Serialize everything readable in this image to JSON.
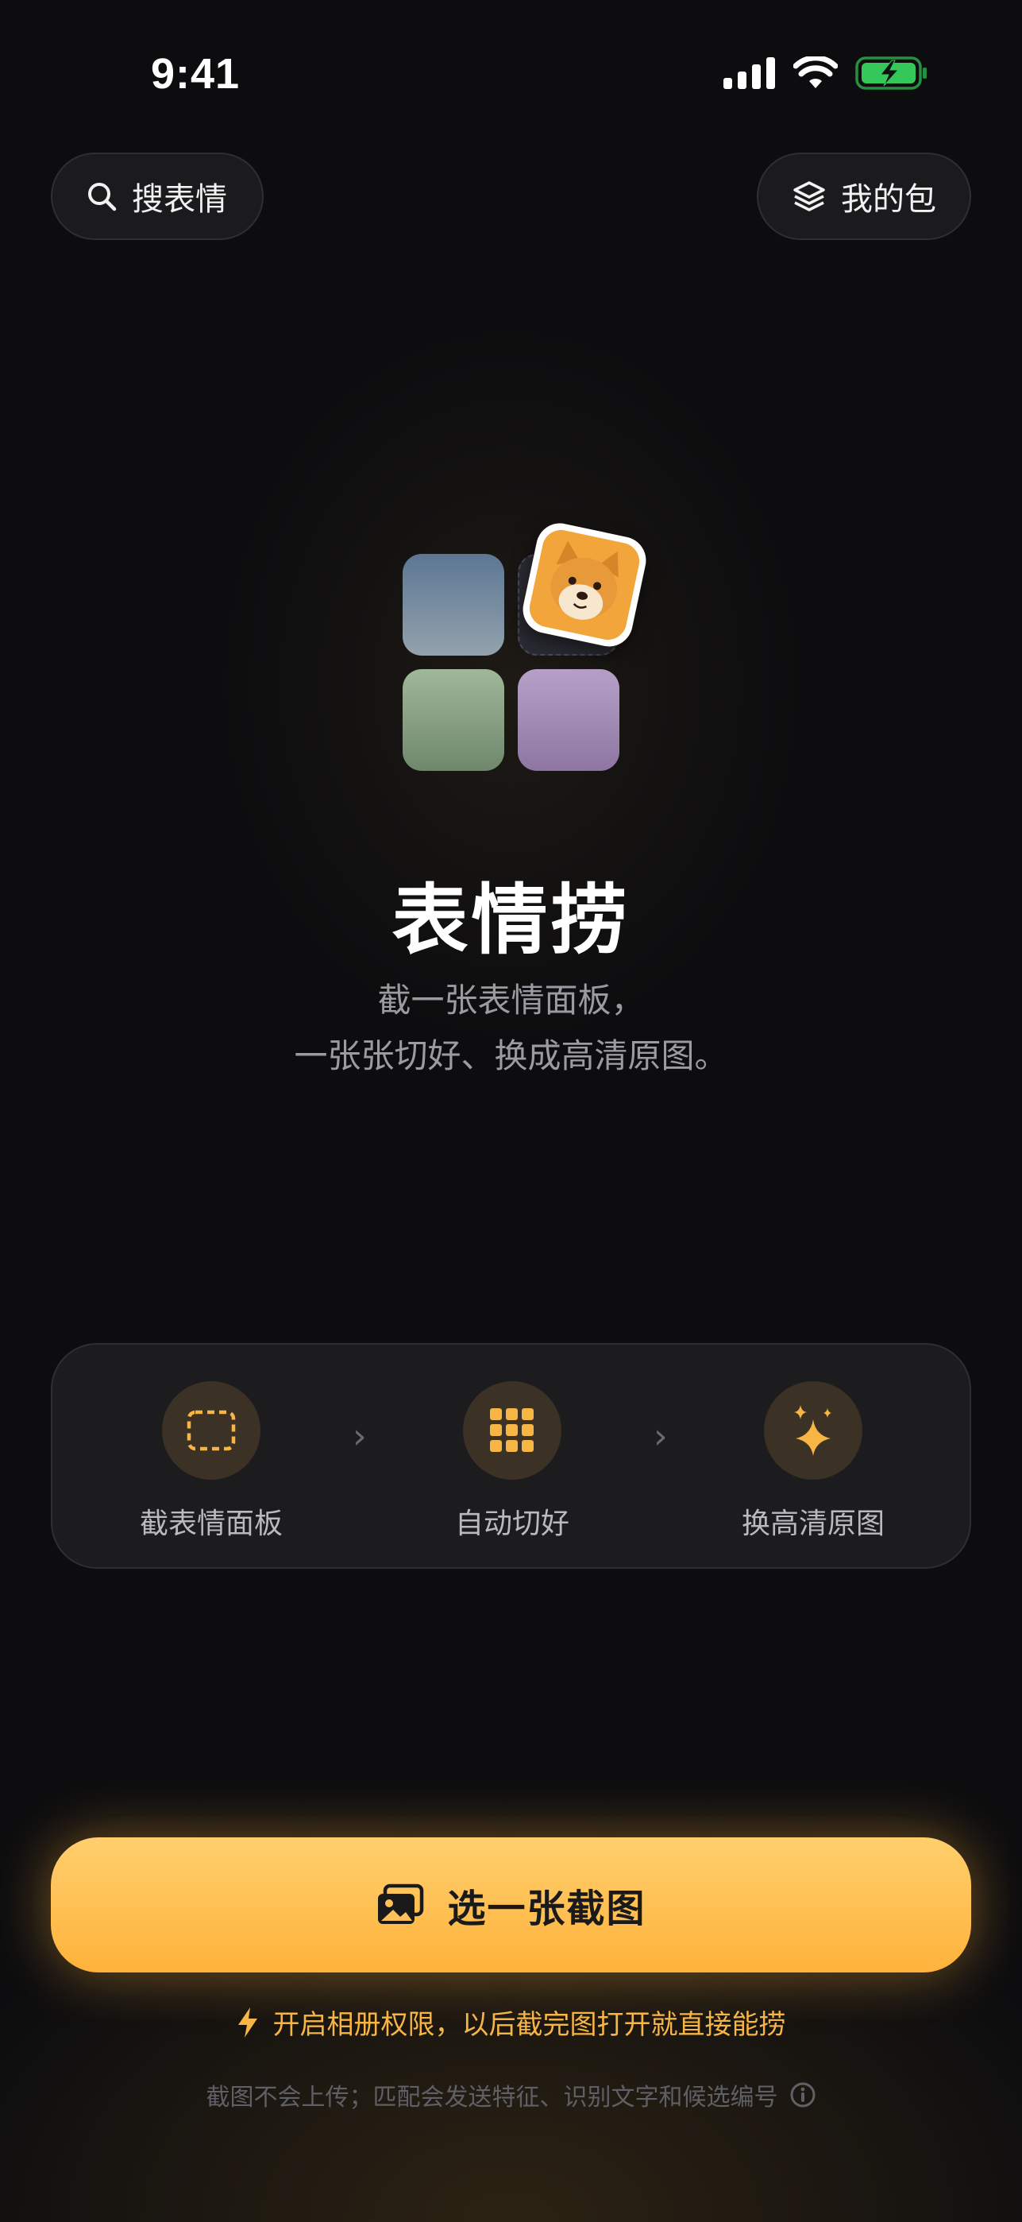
{
  "status_bar": {
    "time": "9:41"
  },
  "header": {
    "search_label": "搜表情",
    "packs_label": "我的包"
  },
  "hero": {
    "title": "表情捞",
    "subtitle_line1": "截一张表情面板，",
    "subtitle_line2": "一张张切好、换成高清原图。"
  },
  "steps": [
    {
      "label": "截表情面板",
      "icon": "dashed-selection-icon"
    },
    {
      "label": "自动切好",
      "icon": "grid-icon"
    },
    {
      "label": "换高清原图",
      "icon": "sparkles-icon"
    }
  ],
  "cta": {
    "label": "选一张截图",
    "icon": "photos-icon"
  },
  "hint": {
    "text": "开启相册权限，以后截完图打开就直接能捞",
    "icon": "bolt-icon"
  },
  "privacy": {
    "text": "截图不会上传；匹配会发送特征、识别文字和候选编号",
    "icon": "info-icon"
  },
  "colors": {
    "background": "#0d0d0f",
    "accent": "#ffb23b",
    "accent_text": "#f6b544",
    "battery": "#34c759"
  }
}
